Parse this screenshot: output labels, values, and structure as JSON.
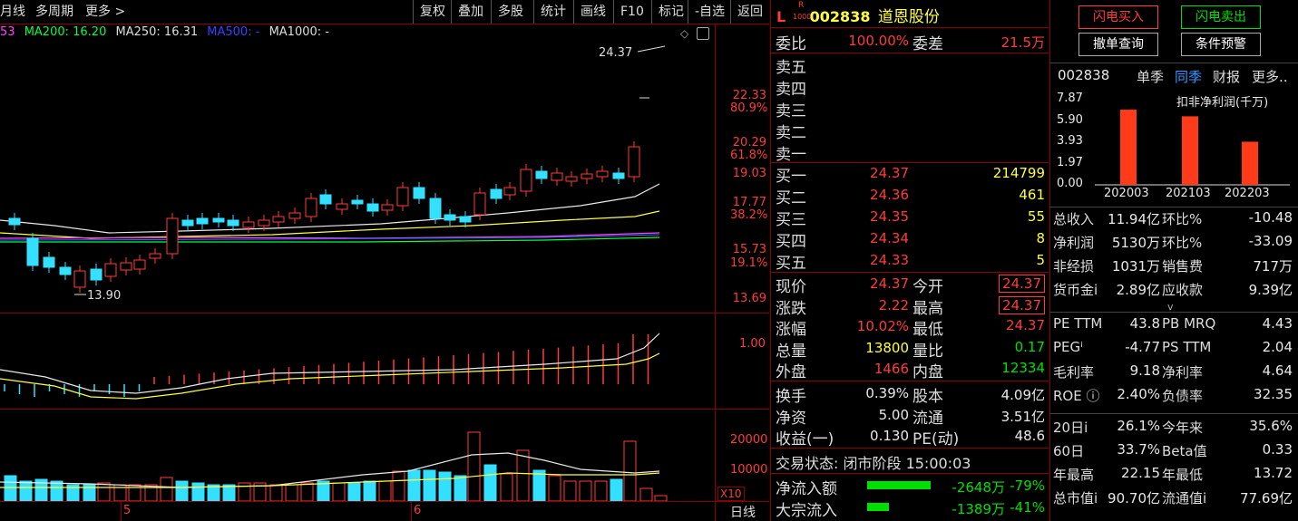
{
  "toolbar": {
    "period": "月线",
    "multi_period": "多周期",
    "more": "更多",
    "buttons": [
      "复权",
      "叠加",
      "多股",
      "统计",
      "画线",
      "F10",
      "标记",
      "-自选",
      "返回"
    ]
  },
  "ma_legend": {
    "prefix": "53",
    "ma200": "MA200: 16.20",
    "ma250": "MA250: 16.31",
    "ma500": "MA500: -",
    "ma1000": "MA1000: -"
  },
  "price_axis": {
    "labels": [
      "22.33",
      "80.9%",
      "20.29",
      "61.8%",
      "19.03",
      "17.77",
      "38.2%",
      "15.73",
      "19.1%",
      "13.69"
    ],
    "high_mark": "24.37",
    "low_mark": "13.90"
  },
  "indicator_axis": {
    "label": "1.00"
  },
  "volume_axis": {
    "labels": [
      "20000",
      "10000"
    ],
    "unit": "X10"
  },
  "date_axis": {
    "labels": [
      "5",
      "6"
    ],
    "mode": "日线"
  },
  "quote": {
    "prefix_l": "L",
    "prefix_r": "R",
    "prefix_num": "1000",
    "code": "002838",
    "name": "道恩股份",
    "weibi_label": "委比",
    "weibi_value": "100.00%",
    "weicha_label": "委差",
    "weicha_value": "21.5万",
    "asks": [
      {
        "label": "卖五",
        "price": "",
        "vol": ""
      },
      {
        "label": "卖四",
        "price": "",
        "vol": ""
      },
      {
        "label": "卖三",
        "price": "",
        "vol": ""
      },
      {
        "label": "卖二",
        "price": "",
        "vol": ""
      },
      {
        "label": "卖一",
        "price": "",
        "vol": ""
      }
    ],
    "bids": [
      {
        "label": "买一",
        "price": "24.37",
        "vol": "214799"
      },
      {
        "label": "买二",
        "price": "24.36",
        "vol": "461"
      },
      {
        "label": "买三",
        "price": "24.35",
        "vol": "55"
      },
      {
        "label": "买四",
        "price": "24.34",
        "vol": "8"
      },
      {
        "label": "买五",
        "price": "24.33",
        "vol": "5"
      }
    ],
    "stats_left": [
      {
        "label": "现价",
        "value": "24.37",
        "color": "#ff3b3b"
      },
      {
        "label": "涨跌",
        "value": "2.22",
        "color": "#ff3b3b"
      },
      {
        "label": "涨幅",
        "value": "10.02%",
        "color": "#ff3b3b"
      },
      {
        "label": "总量",
        "value": "13800",
        "color": "#ffff40"
      },
      {
        "label": "外盘",
        "value": "1466",
        "color": "#ff3b3b"
      }
    ],
    "stats_right": [
      {
        "label": "今开",
        "value": "24.37",
        "color": "#ff3b3b",
        "boxed": true
      },
      {
        "label": "最高",
        "value": "24.37",
        "color": "#ff3b3b",
        "boxed": true
      },
      {
        "label": "最低",
        "value": "24.37",
        "color": "#ff3b3b",
        "boxed": false
      },
      {
        "label": "量比",
        "value": "0.17",
        "color": "#00e000",
        "boxed": false
      },
      {
        "label": "内盘",
        "value": "12334",
        "color": "#00e000",
        "boxed": false
      }
    ],
    "extra_left": [
      {
        "label": "换手",
        "value": "0.39%"
      },
      {
        "label": "净资",
        "value": "5.00"
      },
      {
        "label": "收益(一)",
        "value": "0.130"
      }
    ],
    "extra_right": [
      {
        "label": "股本",
        "value": "4.09亿"
      },
      {
        "label": "流通",
        "value": "3.51亿"
      },
      {
        "label": "PE(动)",
        "value": "48.6"
      }
    ],
    "trade_status": "交易状态: 闭市阶段 15:00:03",
    "flows": [
      {
        "label": "净流入额",
        "value": "-2648万",
        "pct": "-79%"
      },
      {
        "label": "大宗流入",
        "value": "-1389万",
        "pct": "-41%"
      }
    ]
  },
  "side": {
    "buttons": [
      {
        "label": "闪电买入",
        "color": "#ff3b3b"
      },
      {
        "label": "闪电卖出",
        "color": "#00e000"
      },
      {
        "label": "撤单查询",
        "color": "#ffffff"
      },
      {
        "label": "条件预警",
        "color": "#ffffff"
      }
    ],
    "code": "002838",
    "tabs": [
      "单季",
      "同季",
      "财报",
      "更多.."
    ],
    "chart_title": "扣非净利润(千万)",
    "chart_data": {
      "type": "bar",
      "categories": [
        "202003",
        "202103",
        "202203"
      ],
      "values": [
        6.8,
        6.2,
        3.9
      ],
      "title": "扣非净利润(千万)",
      "yticks": [
        "7.87",
        "5.90",
        "3.93",
        "1.97",
        "0.00"
      ],
      "ylim": [
        0,
        7.87
      ],
      "bar_color": "#ff3b1a"
    },
    "fin": [
      {
        "l1": "总收入",
        "v1": "11.94亿",
        "l2": "环比%",
        "v2": "-10.48"
      },
      {
        "l1": "净利润",
        "v1": "5130万",
        "l2": "环比%",
        "v2": "-33.09"
      },
      {
        "l1": "非经损",
        "v1": "1031万",
        "l2": "销售费",
        "v2": "717万"
      },
      {
        "l1": "货币金i",
        "v1": "2.89亿",
        "l2": "应收款",
        "v2": "9.39亿"
      }
    ],
    "val": [
      {
        "l1": "PE TTM",
        "v1": "43.8",
        "l2": "PB MRQ",
        "v2": "4.43"
      },
      {
        "l1": "PEGⁱ",
        "v1": "-4.77",
        "l2": "PS TTM",
        "v2": "2.04"
      },
      {
        "l1": "毛利率",
        "v1": "9.18",
        "l2": "净利率",
        "v2": "4.64"
      },
      {
        "l1": "ROE ⓘ",
        "v1": "2.40%",
        "l2": "负债率",
        "v2": "32.35"
      }
    ],
    "perf": [
      {
        "l1": "20日i",
        "v1": "26.1%",
        "l2": "今年来",
        "v2": "35.6%"
      },
      {
        "l1": "60日",
        "v1": "33.7%",
        "l2": "Beta值",
        "v2": "0.33"
      },
      {
        "l1": "年最高",
        "v1": "22.15",
        "l2": "年最低",
        "v2": "13.72"
      },
      {
        "l1": "总市值i",
        "v1": "90.70亿",
        "l2": "流通值i",
        "v2": "77.69亿"
      }
    ]
  }
}
